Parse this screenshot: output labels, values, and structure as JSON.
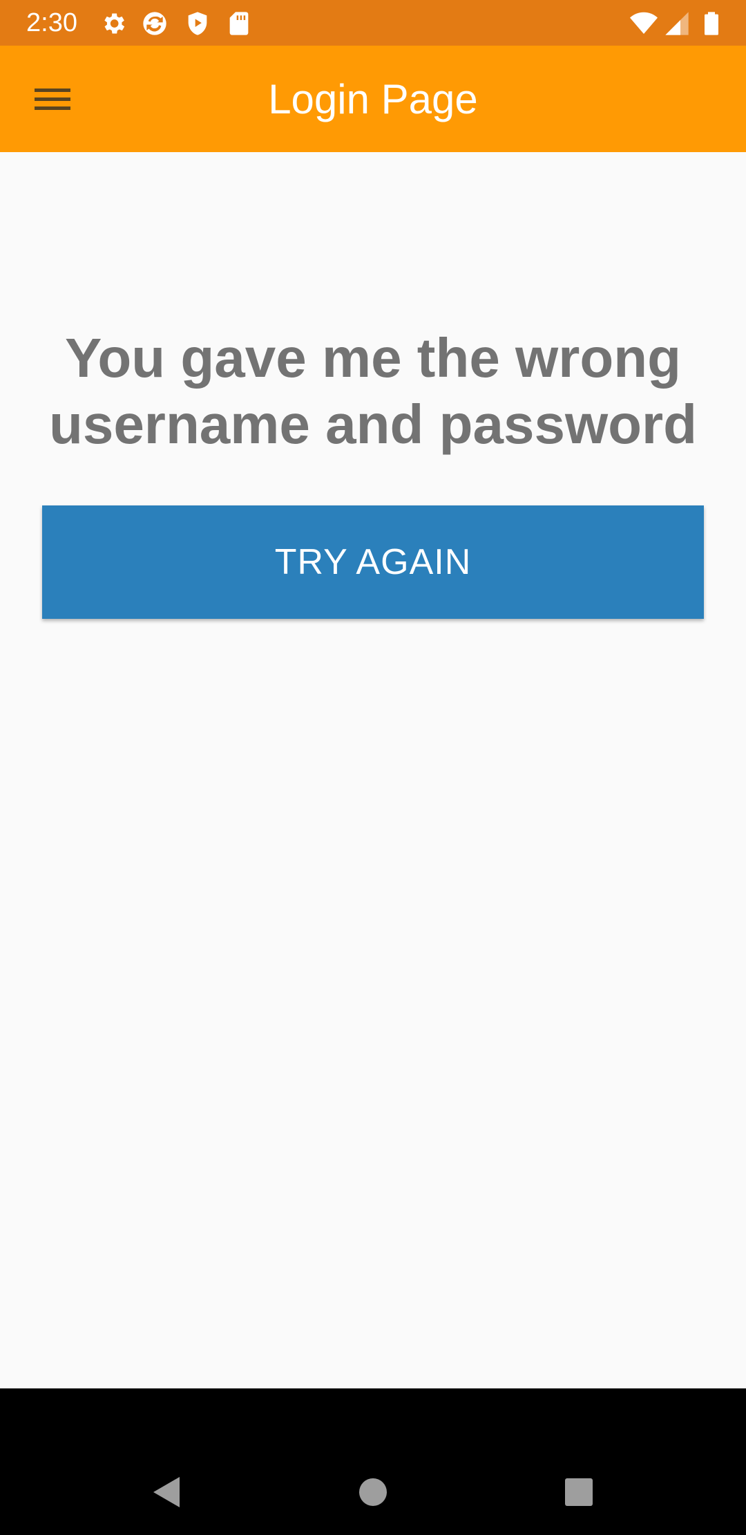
{
  "status_bar": {
    "time": "2:30",
    "icons": [
      "gear-icon",
      "sync-icon",
      "shield-play-icon",
      "sd-card-icon",
      "wifi-icon",
      "signal-icon",
      "battery-icon"
    ]
  },
  "app_bar": {
    "title": "Login Page",
    "menu_icon": "hamburger-menu-icon"
  },
  "content": {
    "message": "You gave me the wrong username and password",
    "button_label": "TRY AGAIN"
  },
  "nav_bar": {
    "icons": [
      "back-icon",
      "home-icon",
      "recents-icon"
    ]
  },
  "colors": {
    "status_bar": "#e37b14",
    "app_bar": "#ff9a04",
    "button": "#2b80bb",
    "message_text": "#737373",
    "background": "#fafafa"
  }
}
